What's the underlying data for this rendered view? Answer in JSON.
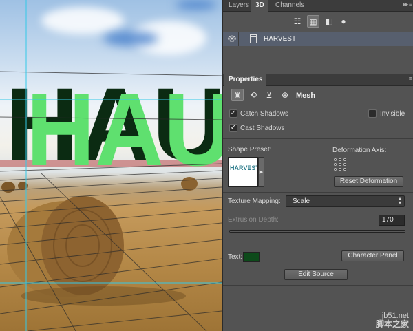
{
  "canvas": {
    "scene_text": "HAU",
    "colors": {
      "letter_face": "#5fe06f",
      "letter_side": "#0b2b12",
      "field": "#b78a48"
    }
  },
  "panel3d": {
    "tabs": [
      {
        "label": "Layers",
        "active": false
      },
      {
        "label": "3D",
        "active": true
      },
      {
        "label": "Channels",
        "active": false
      }
    ],
    "toolbar_icons": [
      "filter-scene-icon",
      "filter-mesh-icon",
      "filter-material-icon",
      "filter-light-icon"
    ],
    "layer": {
      "name": "HARVEST",
      "visible": true
    }
  },
  "properties": {
    "tab_label": "Properties",
    "mode_icons": [
      "mesh-mode-icon",
      "deform-mode-icon",
      "cap-mode-icon",
      "coordinates-mode-icon"
    ],
    "mode_label": "Mesh",
    "catch_shadows": {
      "label": "Catch Shadows",
      "checked": true
    },
    "cast_shadows": {
      "label": "Cast Shadows",
      "checked": true
    },
    "invisible": {
      "label": "Invisible",
      "checked": false
    },
    "shape_preset_label": "Shape Preset:",
    "preset_thumb_text": "HARVEST",
    "deformation_axis_label": "Deformation Axis:",
    "reset_deformation_label": "Reset Deformation",
    "texture_mapping_label": "Texture Mapping:",
    "texture_mapping_value": "Scale",
    "extrusion_depth_label": "Extrusion Depth:",
    "extrusion_depth_value": "170",
    "text_label": "Text:",
    "text_color": "#0d4a1a",
    "character_panel_label": "Character Panel",
    "edit_source_label": "Edit Source"
  },
  "watermark": {
    "site": "jb51.net",
    "name": "脚本之家"
  }
}
